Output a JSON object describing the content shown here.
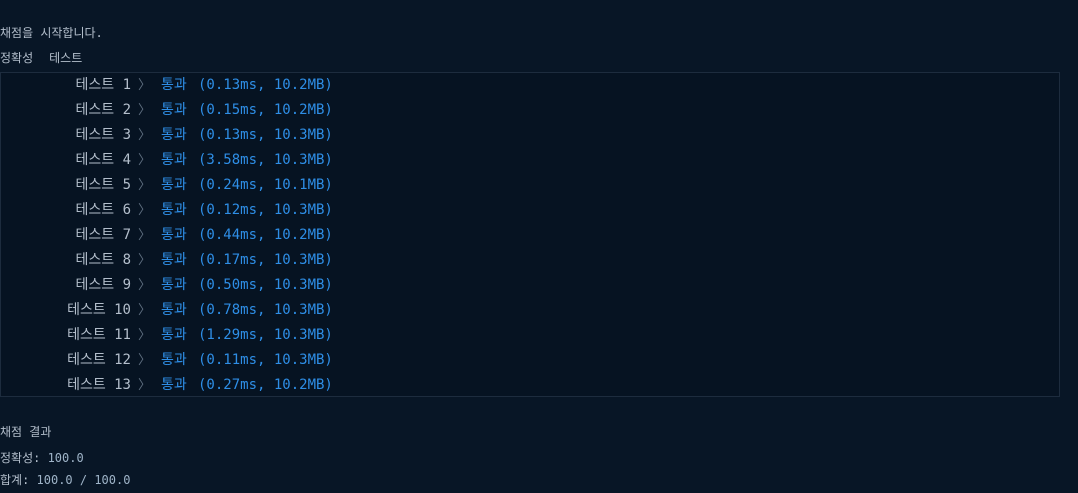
{
  "status_message": "채점을 시작합니다.",
  "header": {
    "category": "정확성",
    "type": "테스트"
  },
  "tests": [
    {
      "name": "테스트 1",
      "result": "통과",
      "detail": "(0.13ms, 10.2MB)"
    },
    {
      "name": "테스트 2",
      "result": "통과",
      "detail": "(0.15ms, 10.2MB)"
    },
    {
      "name": "테스트 3",
      "result": "통과",
      "detail": "(0.13ms, 10.3MB)"
    },
    {
      "name": "테스트 4",
      "result": "통과",
      "detail": "(3.58ms, 10.3MB)"
    },
    {
      "name": "테스트 5",
      "result": "통과",
      "detail": "(0.24ms, 10.1MB)"
    },
    {
      "name": "테스트 6",
      "result": "통과",
      "detail": "(0.12ms, 10.3MB)"
    },
    {
      "name": "테스트 7",
      "result": "통과",
      "detail": "(0.44ms, 10.2MB)"
    },
    {
      "name": "테스트 8",
      "result": "통과",
      "detail": "(0.17ms, 10.3MB)"
    },
    {
      "name": "테스트 9",
      "result": "통과",
      "detail": "(0.50ms, 10.3MB)"
    },
    {
      "name": "테스트 10",
      "result": "통과",
      "detail": "(0.78ms, 10.3MB)"
    },
    {
      "name": "테스트 11",
      "result": "통과",
      "detail": "(1.29ms, 10.3MB)"
    },
    {
      "name": "테스트 12",
      "result": "통과",
      "detail": "(0.11ms, 10.3MB)"
    },
    {
      "name": "테스트 13",
      "result": "통과",
      "detail": "(0.27ms, 10.2MB)"
    }
  ],
  "chevron_icon": "chevron-right-icon",
  "summary": {
    "title": "채점 결과",
    "accuracy_label": "정확성: ",
    "accuracy_value": "100.0",
    "total_label": "합계: ",
    "total_value": "100.0 / 100.0"
  },
  "colors": {
    "background": "#081626",
    "text": "#b4bfcc",
    "pass": "#2e8ee6",
    "border": "#1d2c3e"
  }
}
